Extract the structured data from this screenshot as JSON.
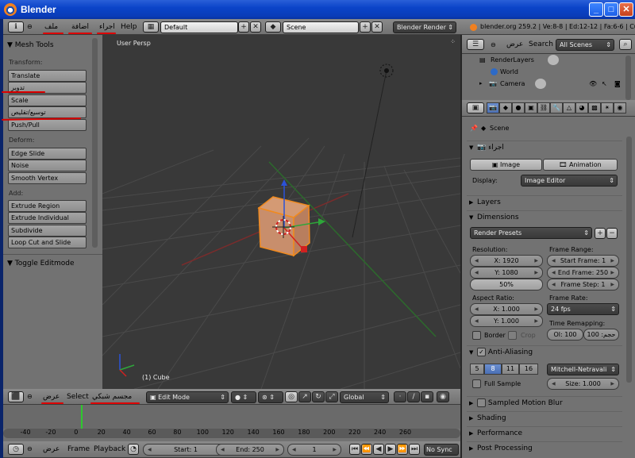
{
  "window": {
    "title": "Blender"
  },
  "top_header": {
    "menus": [
      "ملف",
      "اضافة",
      "اجراء",
      "Help"
    ],
    "screen_layout": "Default",
    "scene": "Scene",
    "render_engine": "Blender Render",
    "stats": "blender.org 259.2 | Ve:8-8 | Ed:12-12 | Fa:6-6 | Cube"
  },
  "tool_shelf": {
    "title": "Mesh Tools",
    "sections": [
      {
        "label": "Transform:",
        "buttons": [
          "Translate",
          "تدوير",
          "Scale",
          "توسيع/تقليص"
        ]
      },
      {
        "label": "Deform:",
        "buttons": [
          "Edge Slide",
          "Noise",
          "Smooth Vertex"
        ]
      },
      {
        "label": "Add:",
        "buttons": [
          "Extrude Region",
          "Extrude Individual",
          "Subdivide",
          "Loop Cut and Slide"
        ]
      }
    ],
    "push_pull": "Push/Pull",
    "operator_panel": "Toggle Editmode"
  },
  "viewport": {
    "label": "User Persp",
    "object_label": "(1) Cube"
  },
  "view3d_header": {
    "menus": [
      "عرض",
      "Select",
      "مجسم شبكي"
    ],
    "mode": "Edit Mode",
    "orientation": "Global"
  },
  "timeline": {
    "ruler": [
      "-40",
      "-20",
      "0",
      "20",
      "40",
      "60",
      "80",
      "100",
      "120",
      "140",
      "160",
      "180",
      "200",
      "220",
      "240",
      "260"
    ],
    "menus": [
      "عرض",
      "Frame",
      "Playback"
    ],
    "start": "Start: 1",
    "end": "End: 250",
    "current": "1",
    "sync": "No Sync"
  },
  "outliner": {
    "view_menu": "عرض",
    "search_menu": "Search",
    "filter": "All Scenes",
    "items": [
      "RenderLayers",
      "World",
      "Camera"
    ]
  },
  "properties": {
    "scene_label": "Scene",
    "render_panel": "اجراء",
    "image_button": "Image",
    "animation_button": "Animation",
    "display_label": "Display:",
    "display_value": "Image Editor",
    "layers_panel": "Layers",
    "dimensions_panel": "Dimensions",
    "render_presets": "Render Presets",
    "resolution_label": "Resolution:",
    "res_x": "X: 1920",
    "res_y": "Y: 1080",
    "res_pct": "50%",
    "frame_range_label": "Frame Range:",
    "start_frame": "Start Frame: 1",
    "end_frame": "End Frame: 250",
    "frame_step": "Frame Step: 1",
    "aspect_label": "Aspect Ratio:",
    "aspect_x": "X: 1.000",
    "aspect_y": "Y: 1.000",
    "frame_rate_label": "Frame Rate:",
    "frame_rate": "24 fps",
    "time_remap_label": "Time Remapping:",
    "remap_old": "Ol: 100",
    "remap_new": "حجم: 100",
    "border_label": "Border",
    "crop_label": "Crop",
    "aa_panel": "Anti-Aliasing",
    "aa_samples": [
      "5",
      "8",
      "11",
      "16"
    ],
    "aa_filter": "Mitchell-Netravali",
    "full_sample": "Full Sample",
    "aa_size": "Size: 1.000",
    "motion_blur": "Sampled Motion Blur",
    "shading": "Shading",
    "performance": "Performance",
    "post_processing": "Post Processing"
  }
}
